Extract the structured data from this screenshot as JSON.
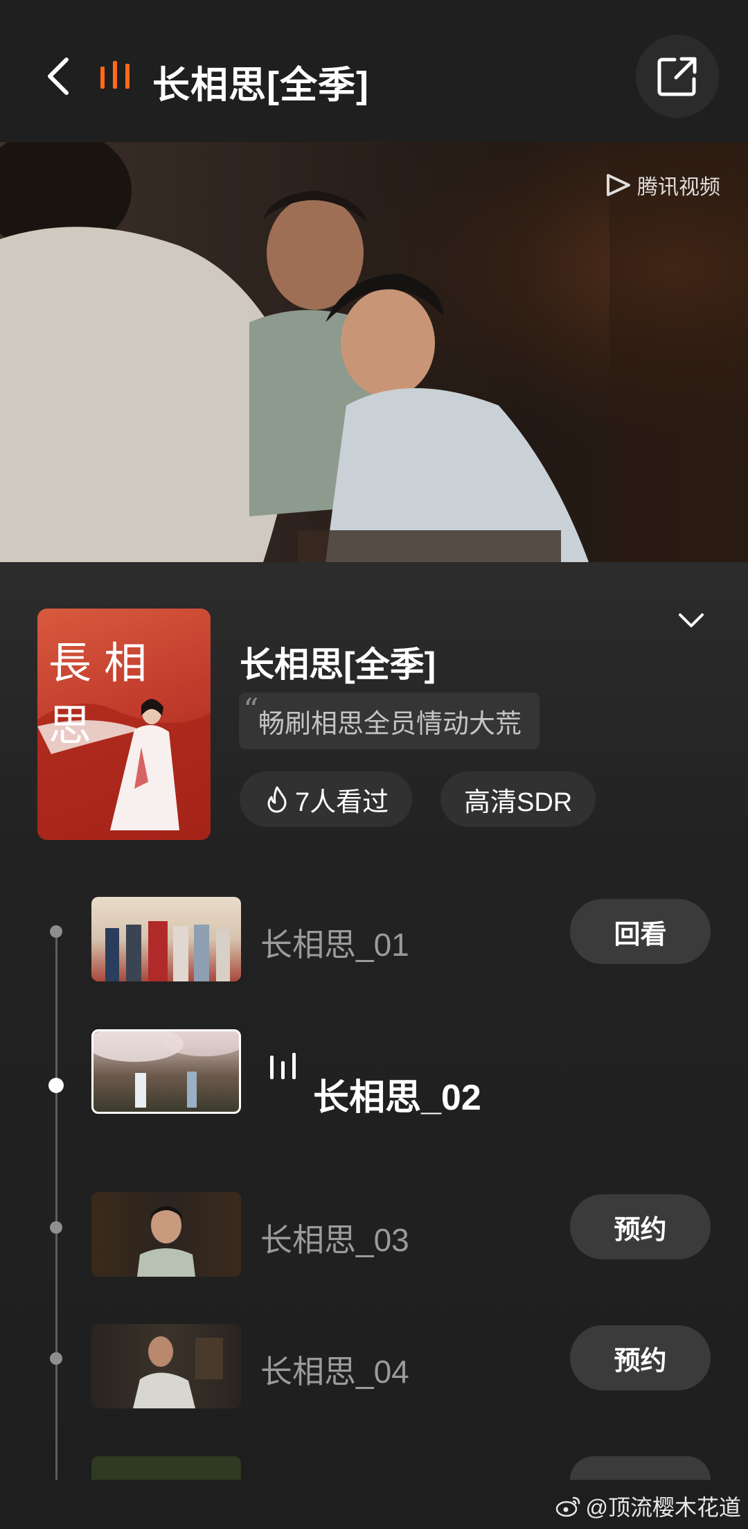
{
  "topbar": {
    "title": "长相思[全季]",
    "back_icon": "chevron-left-icon",
    "playing_icon": "playing-bars-icon",
    "share_icon": "share-external-icon",
    "accent": "#ff6a1a"
  },
  "video": {
    "watermark": "腾讯视频"
  },
  "show": {
    "title": "长相思[全季]",
    "quote": "畅刷相思全员情动大荒",
    "views": "7人看过",
    "quality": "高清SDR",
    "poster_title": "長相思"
  },
  "episodes": [
    {
      "name": "长相思_01",
      "button": "回看"
    },
    {
      "name": "长相思_02"
    },
    {
      "name": "长相思_03",
      "button": "预约"
    },
    {
      "name": "长相思_04",
      "button": "预约"
    }
  ],
  "footer": {
    "weibo_handle": "@顶流樱木花道"
  }
}
